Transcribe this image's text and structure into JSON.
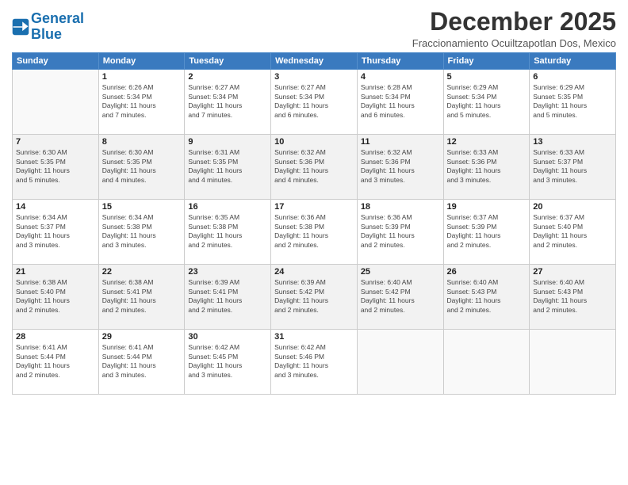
{
  "header": {
    "logo_line1": "General",
    "logo_line2": "Blue",
    "month": "December 2025",
    "location": "Fraccionamiento Ocuiltzapotlan Dos, Mexico"
  },
  "days_of_week": [
    "Sunday",
    "Monday",
    "Tuesday",
    "Wednesday",
    "Thursday",
    "Friday",
    "Saturday"
  ],
  "weeks": [
    [
      {
        "day": "",
        "info": ""
      },
      {
        "day": "1",
        "info": "Sunrise: 6:26 AM\nSunset: 5:34 PM\nDaylight: 11 hours\nand 7 minutes."
      },
      {
        "day": "2",
        "info": "Sunrise: 6:27 AM\nSunset: 5:34 PM\nDaylight: 11 hours\nand 7 minutes."
      },
      {
        "day": "3",
        "info": "Sunrise: 6:27 AM\nSunset: 5:34 PM\nDaylight: 11 hours\nand 6 minutes."
      },
      {
        "day": "4",
        "info": "Sunrise: 6:28 AM\nSunset: 5:34 PM\nDaylight: 11 hours\nand 6 minutes."
      },
      {
        "day": "5",
        "info": "Sunrise: 6:29 AM\nSunset: 5:34 PM\nDaylight: 11 hours\nand 5 minutes."
      },
      {
        "day": "6",
        "info": "Sunrise: 6:29 AM\nSunset: 5:35 PM\nDaylight: 11 hours\nand 5 minutes."
      }
    ],
    [
      {
        "day": "7",
        "info": "Sunrise: 6:30 AM\nSunset: 5:35 PM\nDaylight: 11 hours\nand 5 minutes."
      },
      {
        "day": "8",
        "info": "Sunrise: 6:30 AM\nSunset: 5:35 PM\nDaylight: 11 hours\nand 4 minutes."
      },
      {
        "day": "9",
        "info": "Sunrise: 6:31 AM\nSunset: 5:35 PM\nDaylight: 11 hours\nand 4 minutes."
      },
      {
        "day": "10",
        "info": "Sunrise: 6:32 AM\nSunset: 5:36 PM\nDaylight: 11 hours\nand 4 minutes."
      },
      {
        "day": "11",
        "info": "Sunrise: 6:32 AM\nSunset: 5:36 PM\nDaylight: 11 hours\nand 3 minutes."
      },
      {
        "day": "12",
        "info": "Sunrise: 6:33 AM\nSunset: 5:36 PM\nDaylight: 11 hours\nand 3 minutes."
      },
      {
        "day": "13",
        "info": "Sunrise: 6:33 AM\nSunset: 5:37 PM\nDaylight: 11 hours\nand 3 minutes."
      }
    ],
    [
      {
        "day": "14",
        "info": "Sunrise: 6:34 AM\nSunset: 5:37 PM\nDaylight: 11 hours\nand 3 minutes."
      },
      {
        "day": "15",
        "info": "Sunrise: 6:34 AM\nSunset: 5:38 PM\nDaylight: 11 hours\nand 3 minutes."
      },
      {
        "day": "16",
        "info": "Sunrise: 6:35 AM\nSunset: 5:38 PM\nDaylight: 11 hours\nand 2 minutes."
      },
      {
        "day": "17",
        "info": "Sunrise: 6:36 AM\nSunset: 5:38 PM\nDaylight: 11 hours\nand 2 minutes."
      },
      {
        "day": "18",
        "info": "Sunrise: 6:36 AM\nSunset: 5:39 PM\nDaylight: 11 hours\nand 2 minutes."
      },
      {
        "day": "19",
        "info": "Sunrise: 6:37 AM\nSunset: 5:39 PM\nDaylight: 11 hours\nand 2 minutes."
      },
      {
        "day": "20",
        "info": "Sunrise: 6:37 AM\nSunset: 5:40 PM\nDaylight: 11 hours\nand 2 minutes."
      }
    ],
    [
      {
        "day": "21",
        "info": "Sunrise: 6:38 AM\nSunset: 5:40 PM\nDaylight: 11 hours\nand 2 minutes."
      },
      {
        "day": "22",
        "info": "Sunrise: 6:38 AM\nSunset: 5:41 PM\nDaylight: 11 hours\nand 2 minutes."
      },
      {
        "day": "23",
        "info": "Sunrise: 6:39 AM\nSunset: 5:41 PM\nDaylight: 11 hours\nand 2 minutes."
      },
      {
        "day": "24",
        "info": "Sunrise: 6:39 AM\nSunset: 5:42 PM\nDaylight: 11 hours\nand 2 minutes."
      },
      {
        "day": "25",
        "info": "Sunrise: 6:40 AM\nSunset: 5:42 PM\nDaylight: 11 hours\nand 2 minutes."
      },
      {
        "day": "26",
        "info": "Sunrise: 6:40 AM\nSunset: 5:43 PM\nDaylight: 11 hours\nand 2 minutes."
      },
      {
        "day": "27",
        "info": "Sunrise: 6:40 AM\nSunset: 5:43 PM\nDaylight: 11 hours\nand 2 minutes."
      }
    ],
    [
      {
        "day": "28",
        "info": "Sunrise: 6:41 AM\nSunset: 5:44 PM\nDaylight: 11 hours\nand 2 minutes."
      },
      {
        "day": "29",
        "info": "Sunrise: 6:41 AM\nSunset: 5:44 PM\nDaylight: 11 hours\nand 3 minutes."
      },
      {
        "day": "30",
        "info": "Sunrise: 6:42 AM\nSunset: 5:45 PM\nDaylight: 11 hours\nand 3 minutes."
      },
      {
        "day": "31",
        "info": "Sunrise: 6:42 AM\nSunset: 5:46 PM\nDaylight: 11 hours\nand 3 minutes."
      },
      {
        "day": "",
        "info": ""
      },
      {
        "day": "",
        "info": ""
      },
      {
        "day": "",
        "info": ""
      }
    ]
  ]
}
